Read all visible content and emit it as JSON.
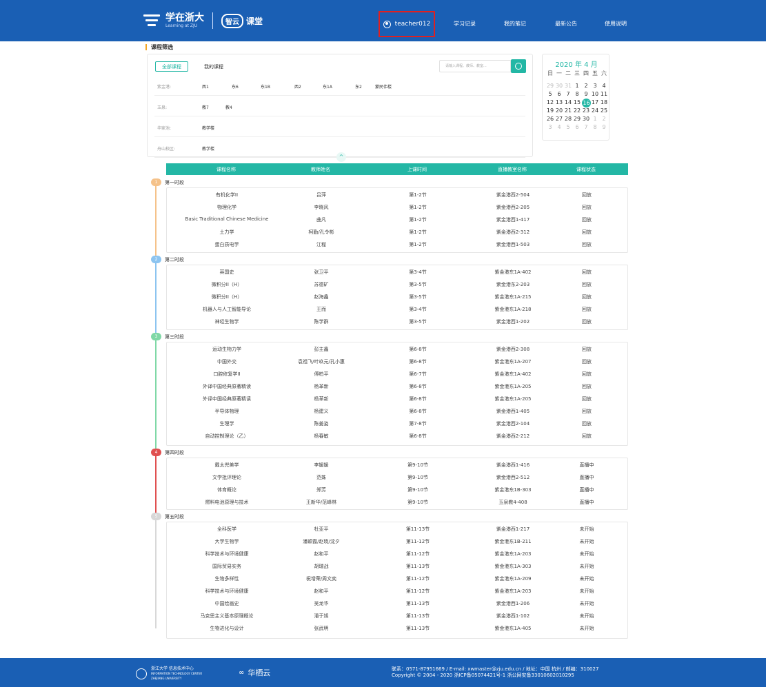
{
  "header": {
    "logo_title": "学在浙大",
    "logo_sub": "Learning at ZJU",
    "badge": "智云",
    "classroom": "课堂",
    "user": "teacher012",
    "nav": [
      "学习记录",
      "我的笔记",
      "最新公告",
      "使用说明"
    ]
  },
  "filter": {
    "section_title": "课程筛选",
    "tab_all": "全部课程",
    "tab_mine": "我的课程",
    "search_placeholder": "请输入课程、教师、教室...",
    "rows": [
      {
        "label": "紫金港:",
        "items": [
          "西1",
          "东6",
          "东1B",
          "西2",
          "东1A",
          "东2",
          "蒙民伟楼"
        ]
      },
      {
        "label": "玉泉:",
        "items": [
          "教7",
          "教4"
        ]
      },
      {
        "label": "华家池:",
        "items": [
          "教学楼"
        ]
      },
      {
        "label": "舟山校区:",
        "items": [
          "教学楼"
        ]
      }
    ],
    "collapse": "^"
  },
  "calendar": {
    "title": "2020 年 4 月",
    "weekdays": [
      "日",
      "一",
      "二",
      "三",
      "四",
      "五",
      "六"
    ],
    "weeks": [
      [
        "29",
        "30",
        "31",
        "1",
        "2",
        "3",
        "4"
      ],
      [
        "5",
        "6",
        "7",
        "8",
        "9",
        "10",
        "11"
      ],
      [
        "12",
        "13",
        "14",
        "15",
        "16",
        "17",
        "18"
      ],
      [
        "19",
        "20",
        "21",
        "22",
        "23",
        "24",
        "25"
      ],
      [
        "26",
        "27",
        "28",
        "29",
        "30",
        "1",
        "2"
      ],
      [
        "3",
        "4",
        "5",
        "6",
        "7",
        "8",
        "9"
      ]
    ],
    "today": "16",
    "accent": "#23b7a5"
  },
  "table": {
    "headers": [
      "课程名称",
      "教师姓名",
      "上课时间",
      "直播教室名称",
      "课程状态"
    ],
    "periods": [
      {
        "badge": "1",
        "color": "#f5c28a",
        "title": "第一时段",
        "rows": [
          [
            "有机化学II",
            "吕萍",
            "第1-2节",
            "紫金港西2-504",
            "回放"
          ],
          [
            "物理化学",
            "李晓风",
            "第1-2节",
            "紫金港西2-205",
            "回放"
          ],
          [
            "Basic Traditional Chinese Medicine",
            "曲凡",
            "第1-2节",
            "紫金港西1-417",
            "回放"
          ],
          [
            "土力学",
            "柯勤/孔令彬",
            "第1-2节",
            "紫金港西2-312",
            "回放"
          ],
          [
            "蛋白质电学",
            "江程",
            "第1-2节",
            "紫金港西1-503",
            "回放"
          ]
        ]
      },
      {
        "badge": "2",
        "color": "#8cc4f0",
        "title": "第二时段",
        "rows": [
          [
            "英国史",
            "张卫平",
            "第3-4节",
            "紫金港东1A-402",
            "回放"
          ],
          [
            "微积分II（H）",
            "苏德矿",
            "第3-5节",
            "紫金港东2-203",
            "回放"
          ],
          [
            "微积分II（H）",
            "赵海鑫",
            "第3-5节",
            "紫金港东1A-215",
            "回放"
          ],
          [
            "机器人与人工智能导论",
            "王而",
            "第3-4节",
            "紫金港东1A-218",
            "回放"
          ],
          [
            "神经生物学",
            "陈学群",
            "第3-5节",
            "紫金港西1-202",
            "回放"
          ]
        ]
      },
      {
        "badge": "3",
        "color": "#7fd8a6",
        "title": "第三时段",
        "rows": [
          [
            "运动生物力学",
            "彭主鑫",
            "第6-8节",
            "紫金港西2-308",
            "回放"
          ],
          [
            "中国外交",
            "袁祖飞/叶玖元/孔小惠",
            "第6-8节",
            "紫金港东1A-207",
            "回放"
          ],
          [
            "口腔修复学II",
            "傅柏平",
            "第6-7节",
            "紫金港东1A-402",
            "回放"
          ],
          [
            "外译中国经典原著精读",
            "杨革新",
            "第6-8节",
            "紫金港东1A-205",
            "回放"
          ],
          [
            "外译中国经典原著精读",
            "杨革新",
            "第6-8节",
            "紫金港东1A-205",
            "回放"
          ],
          [
            "半导体物理",
            "杨建义",
            "第6-8节",
            "紫金港西1-405",
            "回放"
          ],
          [
            "生理学",
            "陈姜姿",
            "第7-8节",
            "紫金港西2-104",
            "回放"
          ],
          [
            "自动控制理论（乙）",
            "杨春敏",
            "第6-8节",
            "紫金港西2-212",
            "回放"
          ]
        ]
      },
      {
        "badge": "4",
        "color": "#e05050",
        "title": "第四时段",
        "rows": [
          [
            "戴太兜美学",
            "李媛媛",
            "第9-10节",
            "紫金港西1-416",
            "直播中"
          ],
          [
            "文学批评理论",
            "范姝",
            "第9-10节",
            "紫金港西2-512",
            "直播中"
          ],
          [
            "体育概论",
            "郑芳",
            "第9-10节",
            "紫金港东1B-303",
            "直播中"
          ],
          [
            "燃料电池原理与技术",
            "王新华/范峰林",
            "第9-10节",
            "玉泉教4-408",
            "直播中"
          ]
        ]
      },
      {
        "badge": "5",
        "color": "#d8d8d8",
        "title": "第五时段",
        "rows": [
          [
            "全科医学",
            "杜亚平",
            "第11-13节",
            "紫金港西1-217",
            "未开始"
          ],
          [
            "大学生物学",
            "潘颖霞/赵晓/沈夕",
            "第11-12节",
            "紫金港东1B-211",
            "未开始"
          ],
          [
            "科学技术与环境健康",
            "赵和平",
            "第11-12节",
            "紫金港东1A-203",
            "未开始"
          ],
          [
            "国际贸易实务",
            "胡瑞战",
            "第11-13节",
            "紫金港东1A-303",
            "未开始"
          ],
          [
            "生物多样性",
            "祝增荣/周文奕",
            "第11-12节",
            "紫金港东1A-209",
            "未开始"
          ],
          [
            "科学技术与环境健康",
            "赵和平",
            "第11-12节",
            "紫金港东1A-203",
            "未开始"
          ],
          [
            "中国绘画史",
            "吴龙华",
            "第11-13节",
            "紫金港西1-206",
            "未开始"
          ],
          [
            "马克思主义基本原理概论",
            "潘于旭",
            "第11-13节",
            "紫金港西1-102",
            "未开始"
          ],
          [
            "生物进化与设计",
            "张武明",
            "第11-13节",
            "紫金港东1A-405",
            "未开始"
          ]
        ]
      }
    ]
  },
  "footer": {
    "center_line1": "浙江大学 信息技术中心",
    "center_line2": "INFORMATION TECHNOLOGY CENTER",
    "center_line3": "ZHEJIANG UNIVERSITY",
    "partner": "华栖云",
    "contact_line1": "联系：0571-87951669 / E-mail: xwmaster@zju.edu.cn / 地址：中国 杭州 / 邮编：310027",
    "contact_line2": "Copyright © 2004 - 2020 浙ICP备05074421号-1 浙公网安备33010602010295"
  }
}
